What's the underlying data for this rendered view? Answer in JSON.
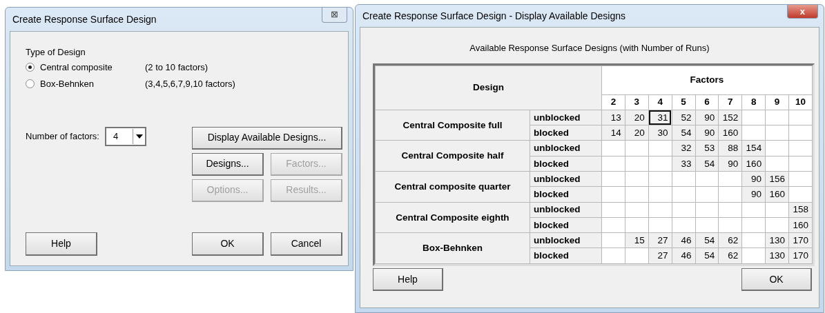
{
  "dialog": {
    "title": "Create Response Surface Design",
    "close": "⊠",
    "type_label": "Type of Design",
    "options": [
      {
        "label": "Central composite",
        "note": "(2 to 10 factors)",
        "selected": true
      },
      {
        "label": "Box-Behnken",
        "note": "(3,4,5,6,7,9,10 factors)",
        "selected": false
      }
    ],
    "factors_label": "Number of factors:",
    "factors_value": "4",
    "buttons": [
      {
        "label": "Display Available Designs...",
        "kind": "wide",
        "disabled": false
      },
      {
        "label": "Designs...",
        "kind": "half",
        "disabled": false
      },
      {
        "label": "Factors...",
        "kind": "half",
        "disabled": true
      },
      {
        "label": "Options...",
        "kind": "half",
        "disabled": true
      },
      {
        "label": "Results...",
        "kind": "half",
        "disabled": true
      }
    ],
    "footer": [
      {
        "label": "Help",
        "kind": "left"
      },
      {
        "label": "OK",
        "kind": "right"
      },
      {
        "label": "Cancel",
        "kind": "right"
      }
    ]
  },
  "display": {
    "title": "Create Response Surface Design - Display Available Designs",
    "close": "x",
    "caption": "Available Response Surface Designs (with Number of Runs)",
    "design_header": "Design",
    "factors_header": "Factors",
    "factors": [
      "2",
      "3",
      "4",
      "5",
      "6",
      "7",
      "8",
      "9",
      "10"
    ],
    "designs": [
      {
        "name": "Central Composite full",
        "rows": [
          {
            "block": "unblocked",
            "cells": [
              {
                "value": "13",
                "selected": false
              },
              {
                "value": "20",
                "selected": false
              },
              {
                "value": "31",
                "selected": true
              },
              {
                "value": "52",
                "selected": false
              },
              {
                "value": "90",
                "selected": false
              },
              {
                "value": "152",
                "selected": false
              },
              null,
              null,
              null
            ]
          },
          {
            "block": "blocked",
            "cells": [
              {
                "value": "14",
                "selected": false
              },
              {
                "value": "20",
                "selected": false
              },
              {
                "value": "30",
                "selected": false
              },
              {
                "value": "54",
                "selected": false
              },
              {
                "value": "90",
                "selected": false
              },
              {
                "value": "160",
                "selected": false
              },
              null,
              null,
              null
            ]
          }
        ]
      },
      {
        "name": "Central Composite half",
        "rows": [
          {
            "block": "unblocked",
            "cells": [
              null,
              null,
              null,
              {
                "value": "32",
                "selected": false
              },
              {
                "value": "53",
                "selected": false
              },
              {
                "value": "88",
                "selected": false
              },
              {
                "value": "154",
                "selected": false
              },
              null,
              null
            ]
          },
          {
            "block": "blocked",
            "cells": [
              null,
              null,
              null,
              {
                "value": "33",
                "selected": false
              },
              {
                "value": "54",
                "selected": false
              },
              {
                "value": "90",
                "selected": false
              },
              {
                "value": "160",
                "selected": false
              },
              null,
              null
            ]
          }
        ]
      },
      {
        "name": "Central composite quarter",
        "rows": [
          {
            "block": "unblocked",
            "cells": [
              null,
              null,
              null,
              null,
              null,
              null,
              {
                "value": "90",
                "selected": false
              },
              {
                "value": "156",
                "selected": false
              },
              null
            ]
          },
          {
            "block": "blocked",
            "cells": [
              null,
              null,
              null,
              null,
              null,
              null,
              {
                "value": "90",
                "selected": false
              },
              {
                "value": "160",
                "selected": false
              },
              null
            ]
          }
        ]
      },
      {
        "name": "Central Composite eighth",
        "rows": [
          {
            "block": "unblocked",
            "cells": [
              null,
              null,
              null,
              null,
              null,
              null,
              null,
              null,
              {
                "value": "158",
                "selected": false
              }
            ]
          },
          {
            "block": "blocked",
            "cells": [
              null,
              null,
              null,
              null,
              null,
              null,
              null,
              null,
              {
                "value": "160",
                "selected": false
              }
            ]
          }
        ]
      },
      {
        "name": "Box-Behnken",
        "rows": [
          {
            "block": "unblocked",
            "cells": [
              null,
              {
                "value": "15",
                "selected": false
              },
              {
                "value": "27",
                "selected": false
              },
              {
                "value": "46",
                "selected": false
              },
              {
                "value": "54",
                "selected": false
              },
              {
                "value": "62",
                "selected": false
              },
              null,
              {
                "value": "130",
                "selected": false
              },
              {
                "value": "170",
                "selected": false
              }
            ]
          },
          {
            "block": "blocked",
            "cells": [
              null,
              null,
              {
                "value": "27",
                "selected": false
              },
              {
                "value": "46",
                "selected": false
              },
              {
                "value": "54",
                "selected": false
              },
              {
                "value": "62",
                "selected": false
              },
              null,
              {
                "value": "130",
                "selected": false
              },
              {
                "value": "170",
                "selected": false
              }
            ]
          }
        ]
      }
    ],
    "footer": [
      {
        "label": "Help",
        "kind": "left"
      },
      {
        "label": "OK",
        "kind": "right"
      }
    ]
  }
}
